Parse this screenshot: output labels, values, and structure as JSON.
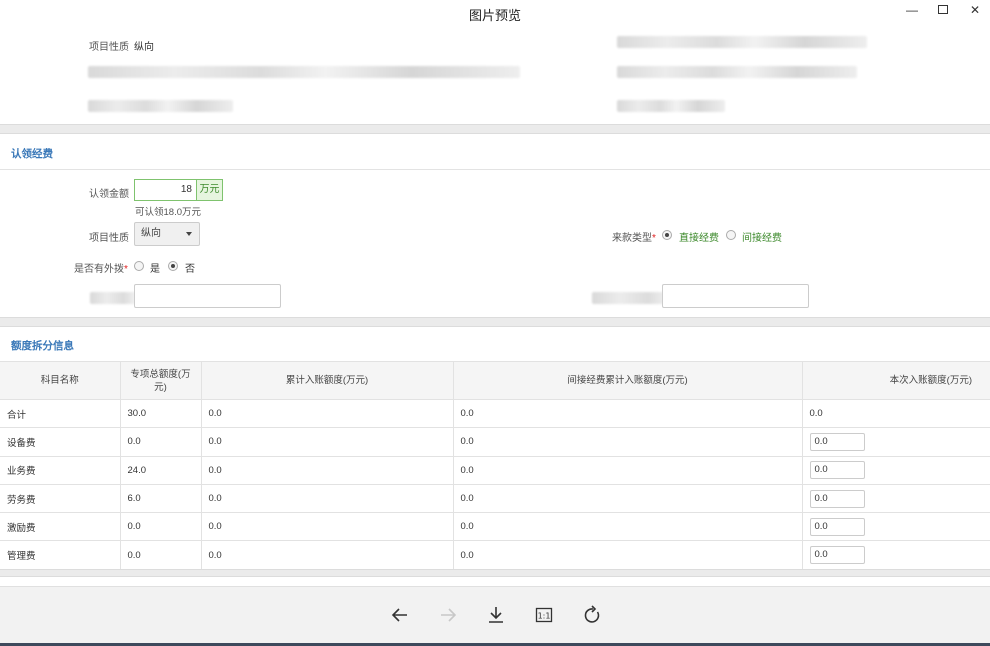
{
  "window": {
    "title": "图片预览"
  },
  "top_info": {
    "nature_label": "项目性质",
    "nature_value": "纵向"
  },
  "claim_section": {
    "title": "认领经费",
    "amount_label": "认领金额",
    "amount_value": "18",
    "amount_unit": "万元",
    "hint": "可认领18.0万元",
    "nature_label": "项目性质",
    "nature_value": "纵向",
    "fund_type_label": "来款类型",
    "fund_type_options": [
      "直接经费",
      "间接经费"
    ],
    "fund_type_selected": "直接经费",
    "external_label": "是否有外拨",
    "external_options": [
      "是",
      "否"
    ],
    "external_selected": "否"
  },
  "split_section": {
    "title": "额度拆分信息",
    "columns": [
      "科目名称",
      "专项总额度(万元)",
      "累计入账额度(万元)",
      "间接经费累计入账额度(万元)",
      "本次入账额度(万元)"
    ],
    "rows": [
      {
        "name": "合计",
        "total": "30.0",
        "accumulated": "0.0",
        "indirect": "0.0",
        "current": "0.0",
        "editable": false
      },
      {
        "name": "设备费",
        "total": "0.0",
        "accumulated": "0.0",
        "indirect": "0.0",
        "current": "0.0",
        "editable": true
      },
      {
        "name": "业务费",
        "total": "24.0",
        "accumulated": "0.0",
        "indirect": "0.0",
        "current": "0.0",
        "editable": true
      },
      {
        "name": "劳务费",
        "total": "6.0",
        "accumulated": "0.0",
        "indirect": "0.0",
        "current": "0.0",
        "editable": true
      },
      {
        "name": "激励费",
        "total": "0.0",
        "accumulated": "0.0",
        "indirect": "0.0",
        "current": "0.0",
        "editable": true
      },
      {
        "name": "管理费",
        "total": "0.0",
        "accumulated": "0.0",
        "indirect": "0.0",
        "current": "0.0",
        "editable": true
      }
    ]
  },
  "toolbar": {
    "icons": [
      "arrow-left-icon",
      "arrow-right-icon",
      "download-icon",
      "actual-size-icon",
      "rotate-icon"
    ],
    "actual_size_label": "1:1"
  },
  "colors": {
    "accent_blue": "#3a78b8",
    "green": "#3d8a2c",
    "required": "#e02020"
  }
}
